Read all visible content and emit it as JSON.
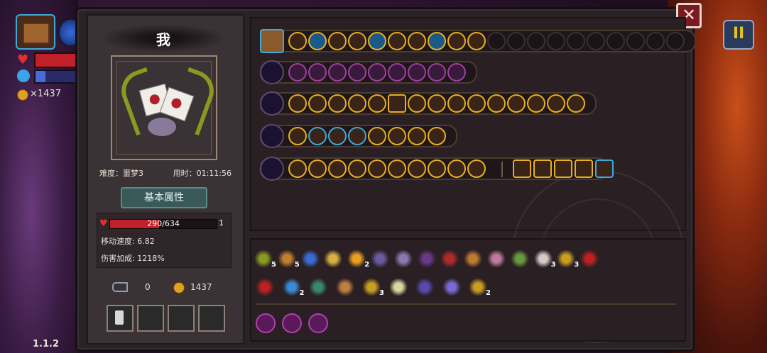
{
  "hud": {
    "coins": "×1437",
    "version": "1.1.2"
  },
  "character": {
    "name": "我",
    "stage_label": "难度：噩梦3",
    "time_label": "用时：01:11:56",
    "attr_tab": "基本属性",
    "hp_text": "290/634",
    "hp_fraction": 0.457,
    "level": "1",
    "move_speed": "移动速度: 6.82",
    "damage_bonus": "伤害加成: 1218%",
    "keys": "0",
    "gold": "1437"
  },
  "buttons": {
    "close": "✕",
    "pause": "II"
  },
  "weapon_rows": [
    {
      "weapon": "chest",
      "filled": 10,
      "empty": 10
    },
    {
      "weapon": "purple-orb",
      "filled": 9,
      "empty": 0
    },
    {
      "weapon": "staff",
      "filled": 15,
      "empty": 0
    },
    {
      "weapon": "wand",
      "filled": 8,
      "empty": 0
    },
    {
      "weapon": "spear",
      "filled": 10,
      "extra": 5
    }
  ],
  "items_row1_counts": [
    "5",
    "5",
    "",
    "",
    "2",
    "",
    "",
    "",
    "",
    "",
    "",
    "",
    "3",
    "3",
    ""
  ],
  "items_row2_counts": [
    "",
    "2",
    "",
    "",
    "3",
    "",
    "",
    "",
    "2"
  ]
}
